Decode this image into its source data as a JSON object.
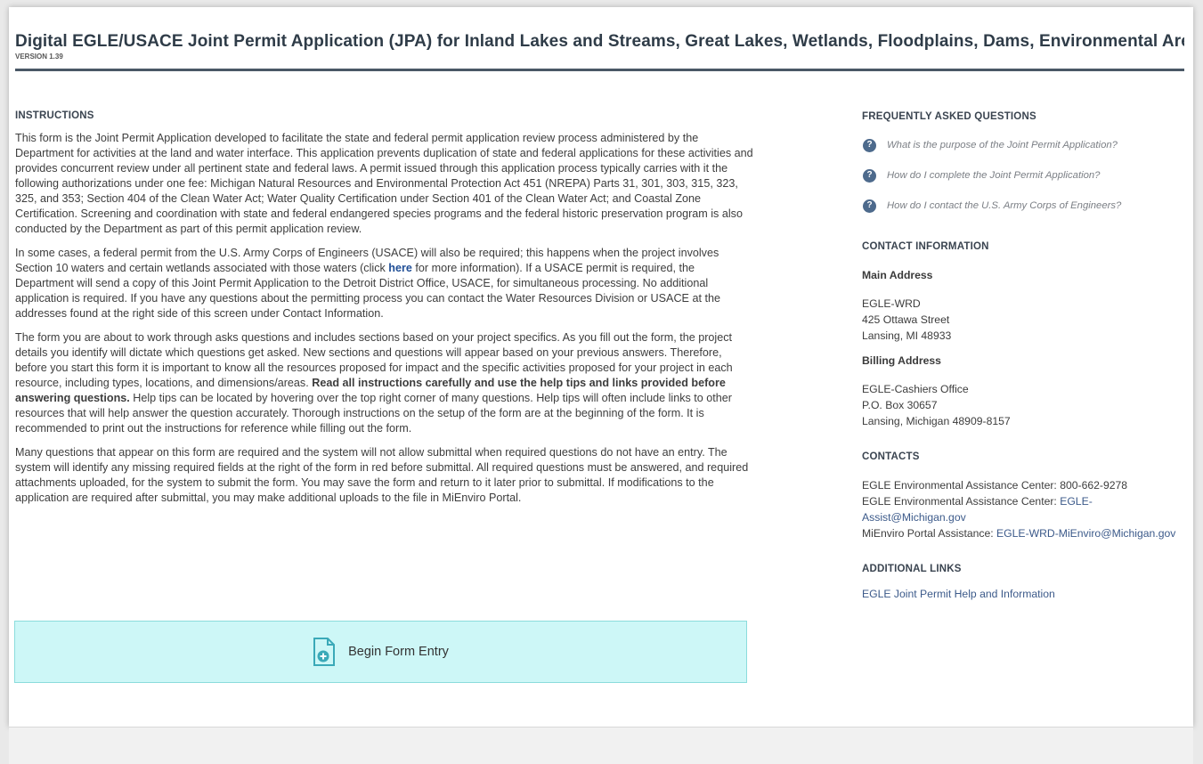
{
  "header": {
    "title": "Digital EGLE/USACE Joint Permit Application (JPA) for Inland Lakes and Streams, Great Lakes, Wetlands, Floodplains, Dams, Environmental Areas, High Risk",
    "version": "VERSION 1.39"
  },
  "instructions": {
    "heading": "INSTRUCTIONS",
    "p1": "This form is the Joint Permit Application developed to facilitate the state and federal permit application review process administered by the Department for activities at the land and water interface. This application prevents duplication of state and federal applications for these activities and provides concurrent review under all pertinent state and federal laws. A permit issued through this application process typically carries with it the following authorizations under one fee: Michigan Natural Resources and Environmental Protection Act 451 (NREPA) Parts 31, 301, 303, 315, 323, 325, and 353; Section 404 of the Clean Water Act; Water Quality Certification under Section 401 of the Clean Water Act; and Coastal Zone Certification. Screening and coordination with state and federal endangered species programs and the federal historic preservation program is also conducted by the Department as part of this permit application review.",
    "p2_before": "In some cases, a federal permit from the U.S. Army Corps of Engineers (USACE) will also be required; this happens when the project involves Section 10 waters and certain wetlands associated with those waters (click ",
    "p2_link": "here",
    "p2_after": " for more information). If a USACE permit is required, the Department will send a copy of this Joint Permit Application to the Detroit District Office, USACE, for simultaneous processing. No additional application is required. If you have any questions about the permitting process you can contact the Water Resources Division or USACE at the addresses found at the right side of this screen under Contact Information.",
    "p3_before": "The form you are about to work through asks questions and includes sections based on your project specifics. As you fill out the form, the project details you identify will dictate which questions get asked. New sections and questions will appear based on your previous answers. Therefore, before you start this form it is important to know all the resources proposed for impact and the specific activities proposed for your project in each resource, including types, locations, and dimensions/areas. ",
    "p3_bold": "Read all instructions carefully and use the help tips and links provided before answering questions.",
    "p3_after": " Help tips can be located by hovering over the top right corner of many questions. Help tips will often include links to other resources that will help answer the question accurately. Thorough instructions on the setup of the form are at the beginning of the form. It is recommended to print out the instructions for reference while filling out the form.",
    "p4": "Many questions that appear on this form are required and the system will not allow submittal when required questions do not have an entry. The system will identify any missing required fields at the right of the form in red before submittal. All required questions must be answered, and required attachments uploaded, for the system to submit the form. You may save the form and return to it later prior to submittal. If modifications to the application are required after submittal, you may make additional uploads to the file in MiEnviro Portal."
  },
  "begin_button": {
    "label": "Begin Form Entry"
  },
  "faq": {
    "heading": "FREQUENTLY ASKED QUESTIONS",
    "items": [
      "What is the purpose of the Joint Permit Application?",
      "How do I complete the Joint Permit Application?",
      "How do I contact the U.S. Army Corps of Engineers?"
    ]
  },
  "contact": {
    "heading": "CONTACT INFORMATION",
    "main_heading": "Main Address",
    "main_lines": [
      "EGLE-WRD",
      "425 Ottawa Street",
      "Lansing, MI 48933"
    ],
    "billing_heading": "Billing Address",
    "billing_lines": [
      "EGLE-Cashiers Office",
      "P.O. Box 30657",
      "Lansing, Michigan 48909-8157"
    ]
  },
  "contacts": {
    "heading": "CONTACTS",
    "phone_line": "EGLE Environmental Assistance Center: 800-662-9278",
    "email_label": "EGLE Environmental Assistance Center: ",
    "email_link": "EGLE-Assist@Michigan.gov",
    "portal_label": "MiEnviro Portal Assistance: ",
    "portal_link": "EGLE-WRD-MiEnviro@Michigan.gov"
  },
  "links": {
    "heading": "ADDITIONAL LINKS",
    "items": [
      "EGLE Joint Permit Help and Information"
    ]
  },
  "colors": {
    "accent": "#4a5866",
    "button_bg": "#cdf7f7",
    "link": "#1f4e96",
    "faq_icon": "#4d6a8c"
  }
}
